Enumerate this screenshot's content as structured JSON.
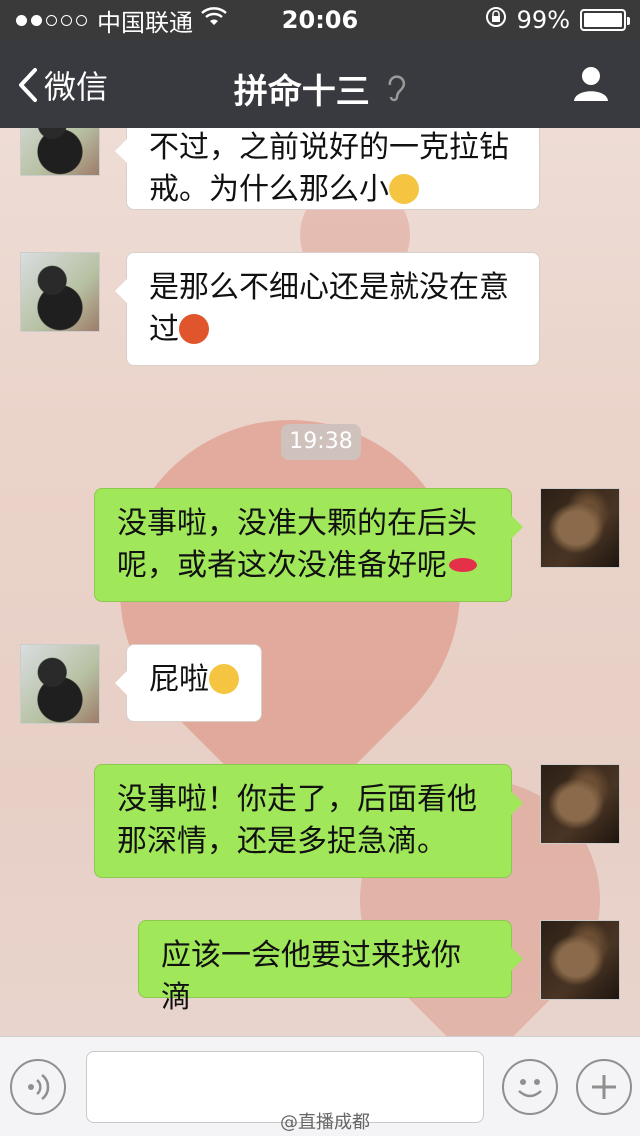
{
  "status_bar": {
    "carrier": "中国联通",
    "time": "20:06",
    "battery": "99%",
    "battery_level": 0.99,
    "signal_bars_filled": 2,
    "signal_bars_total": 5
  },
  "nav": {
    "back_label": "微信",
    "title": "拼命十三",
    "ear_icon": "ear-icon",
    "profile_icon": "profile-icon"
  },
  "messages": [
    {
      "side": "them",
      "text_line1": "不过，之前说好的一克拉钻",
      "text_line2": "戒。为什么那么小",
      "emoji": "embarrassed-emoji"
    },
    {
      "side": "them",
      "text_line1": "是那么不细心还是就没在意",
      "text_line2": "过",
      "emoji": "angry-emoji"
    },
    {
      "side": "time",
      "text": "19:38"
    },
    {
      "side": "me",
      "text_line1": "没事啦，没准大颗的在后头",
      "text_line2": "呢，或者这次没准备好呢",
      "emoji": "lips-emoji"
    },
    {
      "side": "them",
      "text_line1": "屁啦",
      "emoji": "laugh-emoji"
    },
    {
      "side": "me",
      "text_line1": "没事啦！你走了，后面看他",
      "text_line2": "那深情，还是多捉急滴。"
    },
    {
      "side": "me",
      "text_line1": "应该一会他要过来找你滴"
    }
  ],
  "input_bar": {
    "placeholder": "",
    "voice_icon": "voice-icon",
    "emoji_icon": "emoji-icon",
    "plus_icon": "plus-icon"
  },
  "watermark": "@直播成都",
  "colors": {
    "nav_bg": "#393a3f",
    "green_bubble": "#a0e75a",
    "white_bubble": "#ffffff"
  }
}
